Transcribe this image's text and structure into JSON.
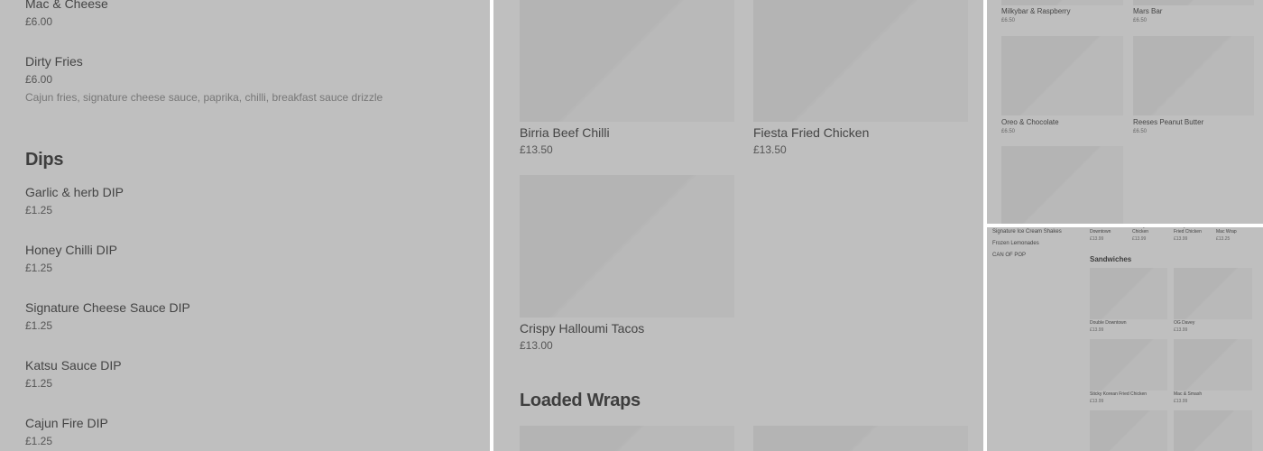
{
  "panel_left": {
    "items_top": [
      {
        "name": "Mac & Cheese",
        "price": "£6.00"
      },
      {
        "name": "Dirty Fries",
        "price": "£6.00",
        "description": "Cajun fries, signature cheese sauce, paprika, chilli, breakfast sauce drizzle"
      }
    ],
    "dips": {
      "heading": "Dips",
      "items": [
        {
          "name": "Garlic & herb DIP",
          "price": "£1.25"
        },
        {
          "name": "Honey Chilli DIP",
          "price": "£1.25"
        },
        {
          "name": "Signature Cheese Sauce DIP",
          "price": "£1.25"
        },
        {
          "name": "Katsu Sauce DIP",
          "price": "£1.25"
        },
        {
          "name": "Cajun Fire DIP",
          "price": "£1.25"
        }
      ]
    }
  },
  "panel_middle": {
    "cards": [
      {
        "name": "Birria Beef Chilli",
        "price": "£13.50"
      },
      {
        "name": "Fiesta Fried Chicken",
        "price": "£13.50"
      },
      {
        "name": "Crispy Halloumi Tacos",
        "price": "£13.00"
      }
    ],
    "section_heading": "Loaded Wraps"
  },
  "panel_top_right": {
    "cards": [
      {
        "name": "Milkybar & Raspberry",
        "price": "£6.50"
      },
      {
        "name": "Mars Bar",
        "price": "£6.50"
      },
      {
        "name": "Oreo & Chocolate",
        "price": "£6.50"
      },
      {
        "name": "Reeses Peanut Butter",
        "price": "£6.50"
      }
    ]
  },
  "panel_bottom_right": {
    "sidebar": [
      "Signature Ice Cream Shakes",
      "Frozen Lemonades",
      "CAN OF POP"
    ],
    "top_row": [
      {
        "name": "Double Downtown",
        "price": "£13.99"
      },
      {
        "name": "Honey Chilli Chicken",
        "price": "£13.99"
      },
      {
        "name": "Sticky Korean Fried Chicken",
        "price": "£13.99"
      },
      {
        "name": "Fried Chicken Mac Wrap",
        "price": "£13.25"
      }
    ],
    "sandwiches": {
      "heading": "Sandwiches",
      "items": [
        {
          "name": "Double Downtown",
          "price": "£13.99"
        },
        {
          "name": "OG Davey",
          "price": "£13.99"
        },
        {
          "name": "Sticky Korean Fried Chicken",
          "price": "£13.99"
        },
        {
          "name": "Mac & Smash",
          "price": "£13.99"
        }
      ]
    }
  }
}
